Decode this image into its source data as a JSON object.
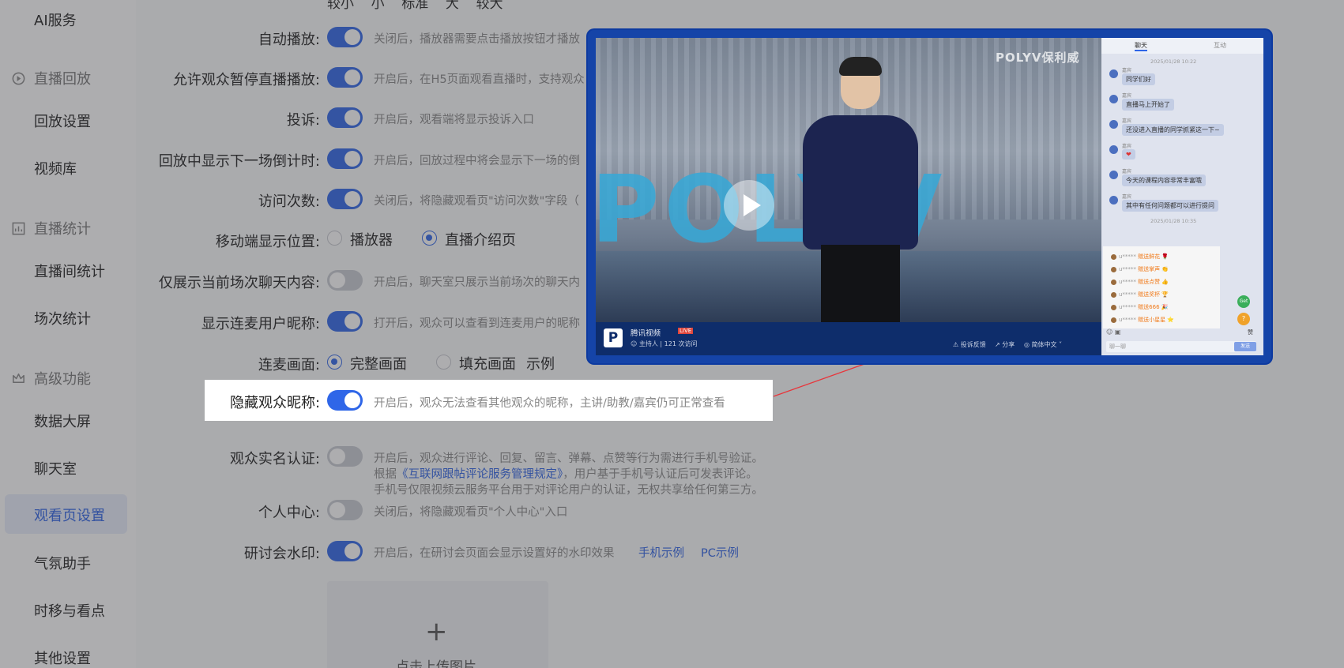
{
  "sidebar": {
    "items": [
      {
        "label": "AI服务"
      },
      {
        "label": "回放设置"
      },
      {
        "label": "视频库"
      },
      {
        "label": "直播间统计"
      },
      {
        "label": "场次统计"
      },
      {
        "label": "数据大屏"
      },
      {
        "label": "聊天室"
      },
      {
        "label": "观看页设置"
      },
      {
        "label": "气氛助手"
      },
      {
        "label": "时移与看点"
      },
      {
        "label": "其他设置"
      }
    ],
    "groups": [
      {
        "label": "直播回放",
        "icon": "replay-icon"
      },
      {
        "label": "直播统计",
        "icon": "chart-icon"
      },
      {
        "label": "高级功能",
        "icon": "crown-icon"
      }
    ],
    "active": "观看页设置"
  },
  "settings": {
    "font_sizes_cut": "较小    小    标准    大    较大",
    "autoplay": {
      "label": "自动播放:",
      "desc": "关闭后，播放器需要点击播放按钮才播放",
      "on": true
    },
    "pause_live": {
      "label": "允许观众暂停直播播放:",
      "desc": "开启后，在H5页面观看直播时，支持观众",
      "on": true
    },
    "report": {
      "label": "投诉:",
      "desc": "开启后，观看端将显示投诉入口",
      "on": true
    },
    "countdown": {
      "label": "回放中显示下一场倒计时:",
      "desc": "开启后，回放过程中将会显示下一场的倒",
      "on": true
    },
    "visits": {
      "label": "访问次数:",
      "desc": "关闭后，将隐藏观看页\"访问次数\"字段（",
      "on": true
    },
    "mobile_position": {
      "label": "移动端显示位置:",
      "options": [
        "播放器",
        "直播介绍页"
      ],
      "selected": "直播介绍页"
    },
    "current_chat": {
      "label": "仅展示当前场次聊天内容:",
      "desc": "开启后，聊天室只展示当前场次的聊天内",
      "on": false
    },
    "mic_nickname": {
      "label": "显示连麦用户昵称:",
      "desc": "打开后，观众可以查看到连麦用户的昵称",
      "on": true
    },
    "mic_view": {
      "label": "连麦画面:",
      "options": [
        "完整画面",
        "填充画面"
      ],
      "selected": "完整画面",
      "example": "示例"
    },
    "hide_nickname": {
      "label": "隐藏观众昵称:",
      "desc": "开启后，观众无法查看其他观众的昵称，主讲/助教/嘉宾仍可正常查看",
      "on": true
    },
    "realname": {
      "label": "观众实名认证:",
      "desc1": "开启后，观众进行评论、回复、留言、弹幕、点赞等行为需进行手机号验证。",
      "desc2_pre": "根据",
      "desc2_link": "《互联网跟帖评论服务管理规定》",
      "desc2_post": "，用户基于手机号认证后可发表评论。",
      "desc3": "手机号仅限视频云服务平台用于对评论用户的认证，无权共享给任何第三方。",
      "on": false
    },
    "user_center": {
      "label": "个人中心:",
      "desc": "关闭后，将隐藏观看页\"个人中心\"入口",
      "on": false
    },
    "watermark": {
      "label": "研讨会水印:",
      "desc": "开启后，在研讨会页面会显示设置好的水印效果",
      "mobile_example": "手机示例",
      "pc_example": "PC示例",
      "on": true
    },
    "upload": {
      "plus": "+",
      "label": "点击上传图片"
    }
  },
  "preview": {
    "brand": "POLYV保利威",
    "backdrop_text": "POLYV",
    "channel": "腾讯视频",
    "live_badge": "LIVE",
    "host": "主持人",
    "visits": "121 次访问",
    "actions": [
      "投诉反馈",
      "分享",
      "简体中文"
    ],
    "chat": {
      "tabs": [
        "聊天",
        "互动"
      ],
      "time1": "2025/01/28 10:22",
      "time2": "2025/01/28 10:35",
      "messages": [
        {
          "name": "嘉宾",
          "text": "同学们好"
        },
        {
          "name": "嘉宾",
          "text": "直播马上开始了"
        },
        {
          "name": "嘉宾",
          "text": "还没进入直播的同学抓紧这一下~"
        },
        {
          "name": "嘉宾",
          "text": "❤"
        },
        {
          "name": "嘉宾",
          "text": "今天的课程内容非常丰富哦"
        },
        {
          "name": "嘉宾",
          "text": "其中有任何问题都可以进行提问"
        }
      ],
      "gifts": [
        {
          "user": "u*****",
          "text": "赠送鲜花"
        },
        {
          "user": "u*****",
          "text": "赠送掌声"
        },
        {
          "user": "u*****",
          "text": "赠送点赞"
        },
        {
          "user": "u*****",
          "text": "赠送奖杯"
        },
        {
          "user": "u*****",
          "text": "赠送666"
        },
        {
          "user": "u*****",
          "text": "赠送小星星"
        }
      ],
      "placeholder": "聊一聊",
      "send": "发送",
      "like": "赞",
      "get": "Get",
      "help": "?"
    }
  },
  "colors": {
    "accent": "#2f66e8",
    "callout": "#e8353b",
    "preview_frame": "#1544a8"
  }
}
